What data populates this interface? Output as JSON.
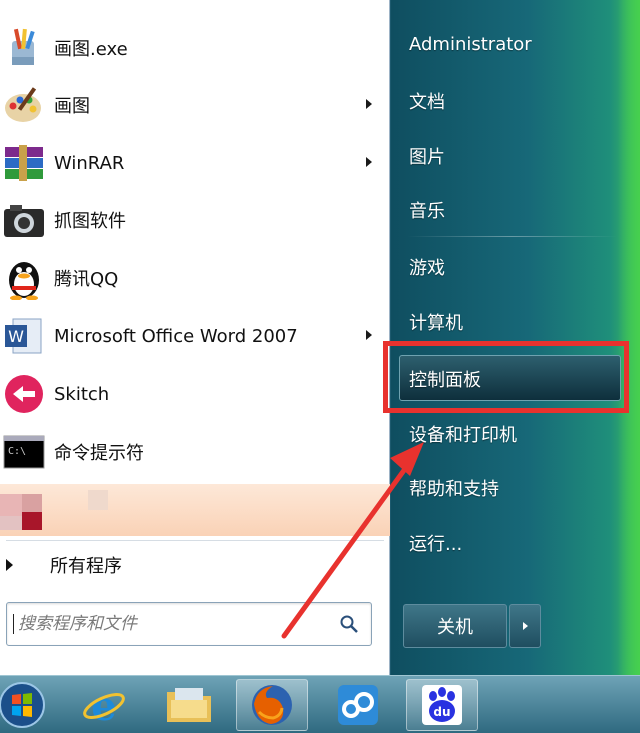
{
  "programs": [
    {
      "label": "画图.exe",
      "has_submenu": false,
      "icon": "paint-brushes-icon"
    },
    {
      "label": "画图",
      "has_submenu": true,
      "icon": "paint-palette-icon"
    },
    {
      "label": "WinRAR",
      "has_submenu": true,
      "icon": "winrar-books-icon"
    },
    {
      "label": "抓图软件",
      "has_submenu": false,
      "icon": "camera-icon"
    },
    {
      "label": "腾讯QQ",
      "has_submenu": false,
      "icon": "qq-penguin-icon"
    },
    {
      "label": "Microsoft Office Word 2007",
      "has_submenu": true,
      "icon": "word-icon"
    },
    {
      "label": "Skitch",
      "has_submenu": false,
      "icon": "skitch-icon"
    },
    {
      "label": "命令提示符",
      "has_submenu": false,
      "icon": "cmd-icon"
    }
  ],
  "all_programs_label": "所有程序",
  "search": {
    "placeholder": "搜索程序和文件"
  },
  "right_items": {
    "user": "Administrator",
    "documents": "文档",
    "pictures": "图片",
    "music": "音乐",
    "games": "游戏",
    "computer": "计算机",
    "control_panel": "控制面板",
    "devices": "设备和打印机",
    "help": "帮助和支持",
    "run": "运行..."
  },
  "shutdown_label": "关机",
  "taskbar_icons": [
    "start-orb-icon",
    "ie-icon",
    "folder-icon",
    "firefox-icon",
    "baidu-cloud-icon",
    "baidu-paw-icon"
  ],
  "colors": {
    "highlight_red": "#e8322e",
    "panel_teal": "#176878"
  }
}
